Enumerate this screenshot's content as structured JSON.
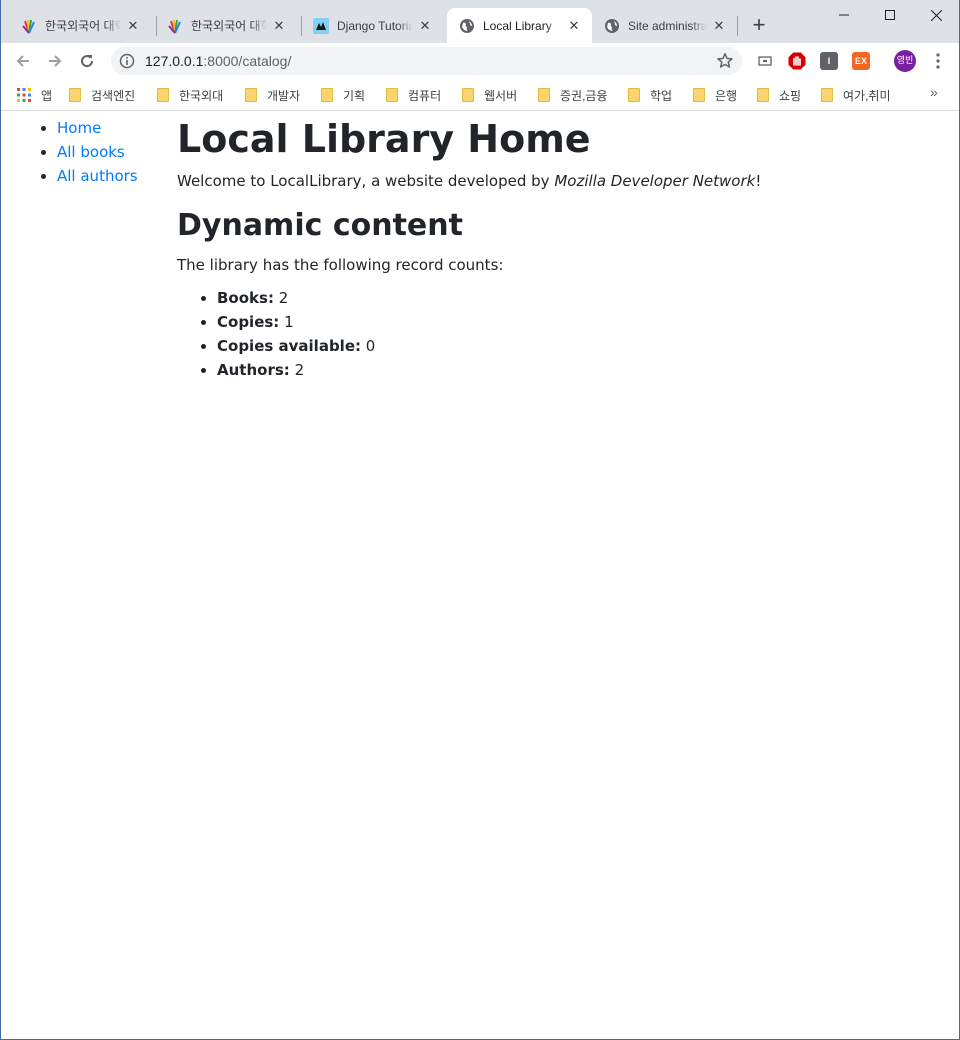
{
  "browser": {
    "tabs": [
      {
        "title": "한국외국어 대학",
        "favicon": "hufs-icon"
      },
      {
        "title": "한국외국어 대학",
        "favicon": "hufs-icon"
      },
      {
        "title": "Django Tutorial",
        "favicon": "mdn-icon"
      },
      {
        "title": "Local Library",
        "favicon": "globe-icon"
      },
      {
        "title": "Site administration",
        "favicon": "globe-icon"
      }
    ],
    "active_tab": 3,
    "address": {
      "host": "127.0.0.1",
      "path": ":8000/catalog/"
    },
    "profile_initials": "영빈",
    "extensions": [
      {
        "name": "cast-icon",
        "label": ""
      },
      {
        "name": "adblock-icon",
        "label": ""
      },
      {
        "name": "instapaper-icon",
        "label": "I"
      },
      {
        "name": "extension-ex-icon",
        "label": "EX"
      }
    ],
    "bookmarks": {
      "apps_label": "앱",
      "folders": [
        "검색엔진",
        "한국외대",
        "개발자",
        "기획",
        "컴퓨터",
        "웹서버",
        "증권,금융",
        "학업",
        "은행",
        "쇼핑",
        "여가,취미"
      ],
      "more": "»"
    }
  },
  "page": {
    "nav": [
      {
        "label": "Home"
      },
      {
        "label": "All books"
      },
      {
        "label": "All authors"
      }
    ],
    "heading": "Local Library Home",
    "welcome_prefix": "Welcome to LocalLibrary, a website developed by ",
    "welcome_emph": "Mozilla Developer Network",
    "welcome_suffix": "!",
    "dynamic_heading": "Dynamic content",
    "counts_intro": "The library has the following record counts:",
    "stats": [
      {
        "label": "Books:",
        "value": "2"
      },
      {
        "label": "Copies:",
        "value": "1"
      },
      {
        "label": "Copies available:",
        "value": "0"
      },
      {
        "label": "Authors:",
        "value": "2"
      }
    ]
  }
}
